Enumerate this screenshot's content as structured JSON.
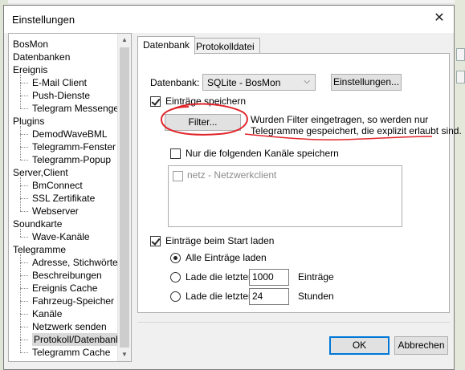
{
  "dialog": {
    "title": "Einstellungen",
    "close_glyph": "✕"
  },
  "tree": {
    "items": [
      {
        "label": "BosMon",
        "level": 0
      },
      {
        "label": "Datenbanken",
        "level": 0
      },
      {
        "label": "Ereignis",
        "level": 0
      },
      {
        "label": "E-Mail Client",
        "level": 1
      },
      {
        "label": "Push-Dienste",
        "level": 1
      },
      {
        "label": "Telegram Messenger",
        "level": 1
      },
      {
        "label": "Plugins",
        "level": 0
      },
      {
        "label": "DemodWaveBML",
        "level": 1
      },
      {
        "label": "Telegramm-Fenster",
        "level": 1
      },
      {
        "label": "Telegramm-Popup",
        "level": 1
      },
      {
        "label": "Server,Client",
        "level": 0
      },
      {
        "label": "BmConnect",
        "level": 1
      },
      {
        "label": "SSL Zertifikate",
        "level": 1
      },
      {
        "label": "Webserver",
        "level": 1
      },
      {
        "label": "Soundkarte",
        "level": 0
      },
      {
        "label": "Wave-Kanäle",
        "level": 1
      },
      {
        "label": "Telegramme",
        "level": 0
      },
      {
        "label": "Adresse, Stichwörter",
        "level": 1
      },
      {
        "label": "Beschreibungen",
        "level": 1
      },
      {
        "label": "Ereignis Cache",
        "level": 1
      },
      {
        "label": "Fahrzeug-Speicher",
        "level": 1
      },
      {
        "label": "Kanäle",
        "level": 1
      },
      {
        "label": "Netzwerk senden",
        "level": 1
      },
      {
        "label": "Protokoll/Datenbank",
        "level": 1,
        "selected": true
      },
      {
        "label": "Telegramm Cache",
        "level": 1
      }
    ]
  },
  "tabs": [
    {
      "label": "Datenbank",
      "active": true
    },
    {
      "label": "Protokolldatei",
      "active": false
    }
  ],
  "panel": {
    "db_label": "Datenbank:",
    "db_value": "SQLite - BosMon",
    "settings_button": "Einstellungen...",
    "save_entries_label": "Einträge speichern",
    "save_entries_checked": true,
    "filter_button": "Filter...",
    "filter_note_line1": "Wurden Filter eingetragen, so werden nur",
    "filter_note_line2": "Telegramme gespeichert, die explizit erlaubt sind.",
    "only_channels_label": "Nur die folgenden Kanäle speichern",
    "only_channels_checked": false,
    "channel_item": "netz - Netzwerkclient",
    "load_on_start_label": "Einträge beim Start laden",
    "load_on_start_checked": true,
    "radio_all": "Alle Einträge laden",
    "radio_last_entries": "Lade die letzten",
    "last_entries_value": "1000",
    "last_entries_unit": "Einträge",
    "radio_last_hours": "Lade die letzten",
    "last_hours_value": "24",
    "last_hours_unit": "Stunden"
  },
  "footer": {
    "ok": "OK",
    "cancel": "Abbrechen"
  },
  "colors": {
    "annotation_red": "#e0252b",
    "accent": "#0078d7"
  },
  "icons": [
    "close-icon",
    "chevron-down-icon",
    "scroll-up-icon",
    "scroll-down-icon"
  ]
}
